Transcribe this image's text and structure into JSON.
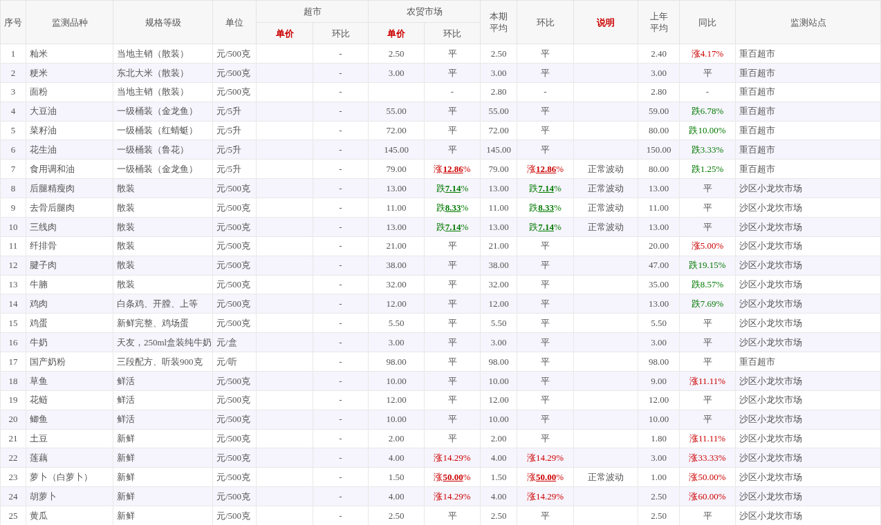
{
  "table": {
    "columns": [
      {
        "label": "序号",
        "emphasized": false
      },
      {
        "label": "监测品种",
        "emphasized": false
      },
      {
        "label": "规格等级",
        "emphasized": false
      },
      {
        "label": "单位",
        "emphasized": false
      },
      {
        "label": "超市",
        "emphasized": false,
        "children": [
          {
            "label": "单价",
            "emphasized": true
          },
          {
            "label": "环比",
            "emphasized": false
          }
        ]
      },
      {
        "label": "农贸市场",
        "emphasized": false,
        "children": [
          {
            "label": "单价",
            "emphasized": true
          },
          {
            "label": "环比",
            "emphasized": false
          }
        ]
      },
      {
        "label": "本期平均",
        "emphasized": false
      },
      {
        "label": "环比",
        "emphasized": false
      },
      {
        "label": "说明",
        "emphasized": true
      },
      {
        "label": "上年平均",
        "emphasized": false
      },
      {
        "label": "同比",
        "emphasized": false
      },
      {
        "label": "监测站点",
        "emphasized": false
      }
    ],
    "rows": [
      {
        "no": "1",
        "item": "籼米",
        "spec": "当地主销（散装）",
        "unit": "元/500克",
        "supermarket_change": {
          "text": "-",
          "kind": "flat"
        },
        "market_price": "2.50",
        "market_change": {
          "text": "平",
          "kind": "flat"
        },
        "period_avg": "2.50",
        "period_change": {
          "text": "平",
          "kind": "flat"
        },
        "last_year_avg": "2.40",
        "yoy_change": {
          "text": "涨4.17%",
          "kind": "up"
        },
        "station": "重百超市"
      },
      {
        "no": "2",
        "item": "粳米",
        "spec": "东北大米（散装）",
        "unit": "元/500克",
        "supermarket_change": {
          "text": "-",
          "kind": "flat"
        },
        "market_price": "3.00",
        "market_change": {
          "text": "平",
          "kind": "flat"
        },
        "period_avg": "3.00",
        "period_change": {
          "text": "平",
          "kind": "flat"
        },
        "last_year_avg": "3.00",
        "yoy_change": {
          "text": "平",
          "kind": "flat"
        },
        "station": "重百超市"
      },
      {
        "no": "3",
        "item": "面粉",
        "spec": "当地主销（散装）",
        "unit": "元/500克",
        "supermarket_change": {
          "text": "-",
          "kind": "flat"
        },
        "market_change": {
          "text": "-",
          "kind": "flat"
        },
        "period_avg": "2.80",
        "period_change": {
          "text": "-",
          "kind": "flat"
        },
        "last_year_avg": "2.80",
        "yoy_change": {
          "text": "-",
          "kind": "flat"
        },
        "station": "重百超市"
      },
      {
        "no": "4",
        "item": "大豆油",
        "spec": "一级桶装（金龙鱼）",
        "unit": "元/5升",
        "supermarket_change": {
          "text": "-",
          "kind": "flat"
        },
        "market_price": "55.00",
        "market_change": {
          "text": "平",
          "kind": "flat"
        },
        "period_avg": "55.00",
        "period_change": {
          "text": "平",
          "kind": "flat"
        },
        "last_year_avg": "59.00",
        "yoy_change": {
          "text": "跌6.78%",
          "kind": "down"
        },
        "station": "重百超市"
      },
      {
        "no": "5",
        "item": "菜籽油",
        "spec": "一级桶装（红蜻蜓）",
        "unit": "元/5升",
        "supermarket_change": {
          "text": "-",
          "kind": "flat"
        },
        "market_price": "72.00",
        "market_change": {
          "text": "平",
          "kind": "flat"
        },
        "period_avg": "72.00",
        "period_change": {
          "text": "平",
          "kind": "flat"
        },
        "last_year_avg": "80.00",
        "yoy_change": {
          "text": "跌10.00%",
          "kind": "down"
        },
        "station": "重百超市"
      },
      {
        "no": "6",
        "item": "花生油",
        "spec": "一级桶装（鲁花）",
        "unit": "元/5升",
        "supermarket_change": {
          "text": "-",
          "kind": "flat"
        },
        "market_price": "145.00",
        "market_change": {
          "text": "平",
          "kind": "flat"
        },
        "period_avg": "145.00",
        "period_change": {
          "text": "平",
          "kind": "flat"
        },
        "last_year_avg": "150.00",
        "yoy_change": {
          "text": "跌3.33%",
          "kind": "down"
        },
        "station": "重百超市"
      },
      {
        "no": "7",
        "item": "食用调和油",
        "spec": "一级桶装（金龙鱼）",
        "unit": "元/5升",
        "supermarket_change": {
          "text": "-",
          "kind": "flat"
        },
        "market_price": "79.00",
        "market_change": {
          "text": "涨**12.86**%",
          "kind": "up"
        },
        "period_avg": "79.00",
        "period_change": {
          "text": "涨**12.86**%",
          "kind": "up"
        },
        "note": "正常波动",
        "last_year_avg": "80.00",
        "yoy_change": {
          "text": "跌1.25%",
          "kind": "down"
        },
        "station": "重百超市"
      },
      {
        "no": "8",
        "item": "后腿精瘦肉",
        "spec": "散装",
        "unit": "元/500克",
        "supermarket_change": {
          "text": "-",
          "kind": "flat"
        },
        "market_price": "13.00",
        "market_change": {
          "text": "跌**7.14**%",
          "kind": "down"
        },
        "period_avg": "13.00",
        "period_change": {
          "text": "跌**7.14**%",
          "kind": "down"
        },
        "note": "正常波动",
        "last_year_avg": "13.00",
        "yoy_change": {
          "text": "平",
          "kind": "flat"
        },
        "station": "沙区小龙坎市场"
      },
      {
        "no": "9",
        "item": "去骨后腿肉",
        "spec": "散装",
        "unit": "元/500克",
        "supermarket_change": {
          "text": "-",
          "kind": "flat"
        },
        "market_price": "11.00",
        "market_change": {
          "text": "跌**8.33**%",
          "kind": "down"
        },
        "period_avg": "11.00",
        "period_change": {
          "text": "跌**8.33**%",
          "kind": "down"
        },
        "note": "正常波动",
        "last_year_avg": "11.00",
        "yoy_change": {
          "text": "平",
          "kind": "flat"
        },
        "station": "沙区小龙坎市场"
      },
      {
        "no": "10",
        "item": "三线肉",
        "spec": "散装",
        "unit": "元/500克",
        "supermarket_change": {
          "text": "-",
          "kind": "flat"
        },
        "market_price": "13.00",
        "market_change": {
          "text": "跌**7.14**%",
          "kind": "down"
        },
        "period_avg": "13.00",
        "period_change": {
          "text": "跌**7.14**%",
          "kind": "down"
        },
        "note": "正常波动",
        "last_year_avg": "13.00",
        "yoy_change": {
          "text": "平",
          "kind": "flat"
        },
        "station": "沙区小龙坎市场"
      },
      {
        "no": "11",
        "item": "纤排骨",
        "spec": "散装",
        "unit": "元/500克",
        "supermarket_change": {
          "text": "-",
          "kind": "flat"
        },
        "market_price": "21.00",
        "market_change": {
          "text": "平",
          "kind": "flat"
        },
        "period_avg": "21.00",
        "period_change": {
          "text": "平",
          "kind": "flat"
        },
        "last_year_avg": "20.00",
        "yoy_change": {
          "text": "涨5.00%",
          "kind": "up"
        },
        "station": "沙区小龙坎市场"
      },
      {
        "no": "12",
        "item": "腱子肉",
        "spec": "散装",
        "unit": "元/500克",
        "supermarket_change": {
          "text": "-",
          "kind": "flat"
        },
        "market_price": "38.00",
        "market_change": {
          "text": "平",
          "kind": "flat"
        },
        "period_avg": "38.00",
        "period_change": {
          "text": "平",
          "kind": "flat"
        },
        "last_year_avg": "47.00",
        "yoy_change": {
          "text": "跌19.15%",
          "kind": "down"
        },
        "station": "沙区小龙坎市场"
      },
      {
        "no": "13",
        "item": "牛腩",
        "spec": "散装",
        "unit": "元/500克",
        "supermarket_change": {
          "text": "-",
          "kind": "flat"
        },
        "market_price": "32.00",
        "market_change": {
          "text": "平",
          "kind": "flat"
        },
        "period_avg": "32.00",
        "period_change": {
          "text": "平",
          "kind": "flat"
        },
        "last_year_avg": "35.00",
        "yoy_change": {
          "text": "跌8.57%",
          "kind": "down"
        },
        "station": "沙区小龙坎市场"
      },
      {
        "no": "14",
        "item": "鸡肉",
        "spec": "白条鸡、开膛、上等",
        "unit": "元/500克",
        "supermarket_change": {
          "text": "-",
          "kind": "flat"
        },
        "market_price": "12.00",
        "market_change": {
          "text": "平",
          "kind": "flat"
        },
        "period_avg": "12.00",
        "period_change": {
          "text": "平",
          "kind": "flat"
        },
        "last_year_avg": "13.00",
        "yoy_change": {
          "text": "跌7.69%",
          "kind": "down"
        },
        "station": "沙区小龙坎市场"
      },
      {
        "no": "15",
        "item": "鸡蛋",
        "spec": "新鲜完整、鸡场蛋",
        "unit": "元/500克",
        "supermarket_change": {
          "text": "-",
          "kind": "flat"
        },
        "market_price": "5.50",
        "market_change": {
          "text": "平",
          "kind": "flat"
        },
        "period_avg": "5.50",
        "period_change": {
          "text": "平",
          "kind": "flat"
        },
        "last_year_avg": "5.50",
        "yoy_change": {
          "text": "平",
          "kind": "flat"
        },
        "station": "沙区小龙坎市场"
      },
      {
        "no": "16",
        "item": "牛奶",
        "spec": "天友，250ml盒装纯牛奶",
        "unit": "元/盒",
        "supermarket_change": {
          "text": "-",
          "kind": "flat"
        },
        "market_price": "3.00",
        "market_change": {
          "text": "平",
          "kind": "flat"
        },
        "period_avg": "3.00",
        "period_change": {
          "text": "平",
          "kind": "flat"
        },
        "last_year_avg": "3.00",
        "yoy_change": {
          "text": "平",
          "kind": "flat"
        },
        "station": "沙区小龙坎市场"
      },
      {
        "no": "17",
        "item": "国产奶粉",
        "spec": "三段配方、听装900克",
        "unit": "元/听",
        "supermarket_change": {
          "text": "-",
          "kind": "flat"
        },
        "market_price": "98.00",
        "market_change": {
          "text": "平",
          "kind": "flat"
        },
        "period_avg": "98.00",
        "period_change": {
          "text": "平",
          "kind": "flat"
        },
        "last_year_avg": "98.00",
        "yoy_change": {
          "text": "平",
          "kind": "flat"
        },
        "station": "重百超市"
      },
      {
        "no": "18",
        "item": "草鱼",
        "spec": "鲜活",
        "unit": "元/500克",
        "supermarket_change": {
          "text": "-",
          "kind": "flat"
        },
        "market_price": "10.00",
        "market_change": {
          "text": "平",
          "kind": "flat"
        },
        "period_avg": "10.00",
        "period_change": {
          "text": "平",
          "kind": "flat"
        },
        "last_year_avg": "9.00",
        "yoy_change": {
          "text": "涨11.11%",
          "kind": "up"
        },
        "station": "沙区小龙坎市场"
      },
      {
        "no": "19",
        "item": "花鲢",
        "spec": "鲜活",
        "unit": "元/500克",
        "supermarket_change": {
          "text": "-",
          "kind": "flat"
        },
        "market_price": "12.00",
        "market_change": {
          "text": "平",
          "kind": "flat"
        },
        "period_avg": "12.00",
        "period_change": {
          "text": "平",
          "kind": "flat"
        },
        "last_year_avg": "12.00",
        "yoy_change": {
          "text": "平",
          "kind": "flat"
        },
        "station": "沙区小龙坎市场"
      },
      {
        "no": "20",
        "item": "鲫鱼",
        "spec": "鲜活",
        "unit": "元/500克",
        "supermarket_change": {
          "text": "-",
          "kind": "flat"
        },
        "market_price": "10.00",
        "market_change": {
          "text": "平",
          "kind": "flat"
        },
        "period_avg": "10.00",
        "period_change": {
          "text": "平",
          "kind": "flat"
        },
        "last_year_avg": "10.00",
        "yoy_change": {
          "text": "平",
          "kind": "flat"
        },
        "station": "沙区小龙坎市场"
      },
      {
        "no": "21",
        "item": "土豆",
        "spec": "新鲜",
        "unit": "元/500克",
        "supermarket_change": {
          "text": "-",
          "kind": "flat"
        },
        "market_price": "2.00",
        "market_change": {
          "text": "平",
          "kind": "flat"
        },
        "period_avg": "2.00",
        "period_change": {
          "text": "平",
          "kind": "flat"
        },
        "last_year_avg": "1.80",
        "yoy_change": {
          "text": "涨11.11%",
          "kind": "up"
        },
        "station": "沙区小龙坎市场"
      },
      {
        "no": "22",
        "item": "莲藕",
        "spec": "新鲜",
        "unit": "元/500克",
        "supermarket_change": {
          "text": "-",
          "kind": "flat"
        },
        "market_price": "4.00",
        "market_change": {
          "text": "涨14.29%",
          "kind": "up"
        },
        "period_avg": "4.00",
        "period_change": {
          "text": "涨14.29%",
          "kind": "up"
        },
        "last_year_avg": "3.00",
        "yoy_change": {
          "text": "涨33.33%",
          "kind": "up"
        },
        "station": "沙区小龙坎市场"
      },
      {
        "no": "23",
        "item": "萝卜（白萝卜）",
        "spec": "新鲜",
        "unit": "元/500克",
        "supermarket_change": {
          "text": "-",
          "kind": "flat"
        },
        "market_price": "1.50",
        "market_change": {
          "text": "涨**50.00**%",
          "kind": "up"
        },
        "period_avg": "1.50",
        "period_change": {
          "text": "涨**50.00**%",
          "kind": "up"
        },
        "note": "正常波动",
        "last_year_avg": "1.00",
        "yoy_change": {
          "text": "涨50.00%",
          "kind": "up"
        },
        "station": "沙区小龙坎市场"
      },
      {
        "no": "24",
        "item": "胡萝卜",
        "spec": "新鲜",
        "unit": "元/500克",
        "supermarket_change": {
          "text": "-",
          "kind": "flat"
        },
        "market_price": "4.00",
        "market_change": {
          "text": "涨14.29%",
          "kind": "up"
        },
        "period_avg": "4.00",
        "period_change": {
          "text": "涨14.29%",
          "kind": "up"
        },
        "last_year_avg": "2.50",
        "yoy_change": {
          "text": "涨60.00%",
          "kind": "up"
        },
        "station": "沙区小龙坎市场"
      },
      {
        "no": "25",
        "item": "黄瓜",
        "spec": "新鲜",
        "unit": "元/500克",
        "supermarket_change": {
          "text": "-",
          "kind": "flat"
        },
        "market_price": "2.50",
        "market_change": {
          "text": "平",
          "kind": "flat"
        },
        "period_avg": "2.50",
        "period_change": {
          "text": "平",
          "kind": "flat"
        },
        "last_year_avg": "2.50",
        "yoy_change": {
          "text": "平",
          "kind": "flat"
        },
        "station": "沙区小龙坎市场"
      }
    ]
  }
}
